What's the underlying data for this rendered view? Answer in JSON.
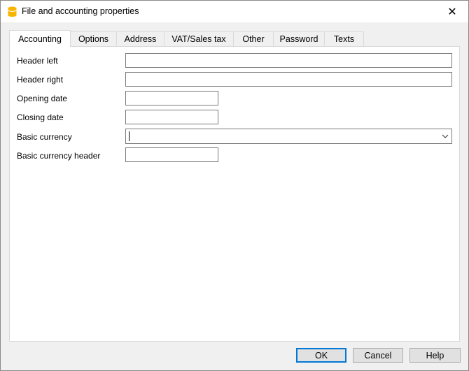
{
  "window": {
    "title": "File and accounting properties"
  },
  "tabs": [
    {
      "label": "Accounting",
      "selected": true
    },
    {
      "label": "Options"
    },
    {
      "label": "Address"
    },
    {
      "label": "VAT/Sales tax"
    },
    {
      "label": "Other"
    },
    {
      "label": "Password"
    },
    {
      "label": "Texts"
    }
  ],
  "fields": [
    {
      "label": "Header left",
      "value": ""
    },
    {
      "label": "Header right",
      "value": ""
    },
    {
      "label": "Opening date",
      "value": ""
    },
    {
      "label": "Closing date",
      "value": ""
    },
    {
      "label": "Basic currency",
      "value": ""
    },
    {
      "label": "Basic currency header",
      "value": ""
    }
  ],
  "buttons": {
    "ok": "OK",
    "cancel": "Cancel",
    "help": "Help"
  },
  "colors": {
    "accent": "#0078d7",
    "icon": "#f7b500"
  }
}
